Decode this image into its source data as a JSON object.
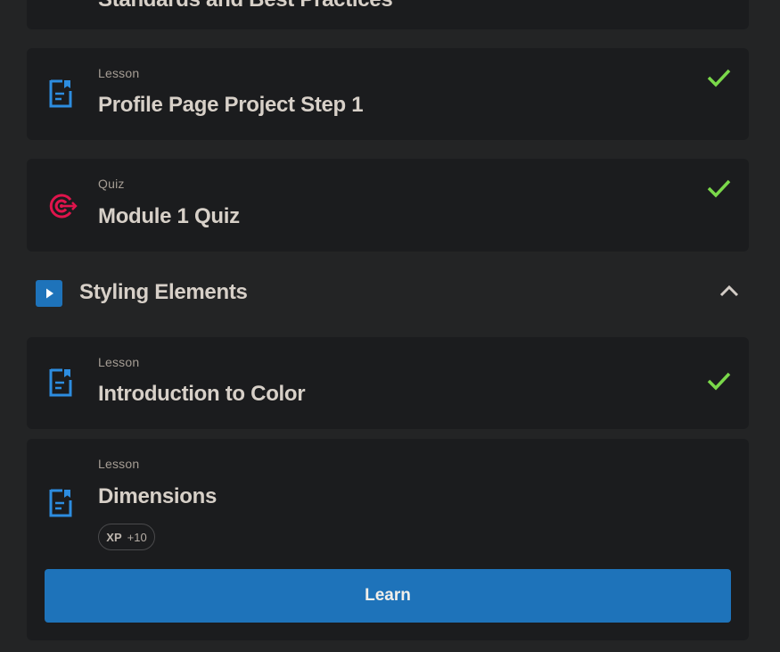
{
  "partial_item": {
    "title": "Standards and Best Practices"
  },
  "items": [
    {
      "type": "Lesson",
      "title": "Profile Page Project Step 1",
      "icon": "lesson-document-icon",
      "completed": true
    },
    {
      "type": "Quiz",
      "title": "Module 1 Quiz",
      "icon": "quiz-target-icon",
      "completed": true
    }
  ],
  "section": {
    "title": "Styling Elements",
    "icon": "play-icon",
    "expanded": true
  },
  "section_items": [
    {
      "type": "Lesson",
      "title": "Introduction to Color",
      "icon": "lesson-document-icon",
      "completed": true
    },
    {
      "type": "Lesson",
      "title": "Dimensions",
      "icon": "lesson-document-icon",
      "completed": false,
      "xp_label": "XP",
      "xp_value": "+10",
      "action_label": "Learn"
    }
  ],
  "colors": {
    "background": "#232425",
    "card": "#1b1c1e",
    "accent_blue": "#1e73ba",
    "check_green": "#7ad84a",
    "quiz_red": "#e0144c"
  }
}
